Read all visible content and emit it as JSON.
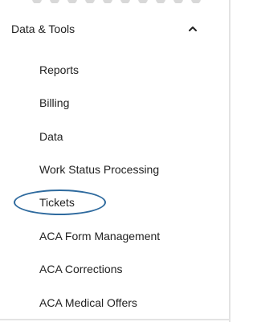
{
  "section": {
    "title": "Data & Tools",
    "collapse_icon": "chevron-up-icon"
  },
  "menu": {
    "items": [
      {
        "label": "Reports"
      },
      {
        "label": "Billing"
      },
      {
        "label": "Data"
      },
      {
        "label": "Work Status Processing"
      },
      {
        "label": "Tickets",
        "highlighted": true
      },
      {
        "label": "ACA Form Management"
      },
      {
        "label": "ACA Corrections"
      },
      {
        "label": "ACA Medical Offers"
      }
    ]
  },
  "colors": {
    "highlight": "#2e6a9e",
    "divider": "#e3e3e3"
  }
}
